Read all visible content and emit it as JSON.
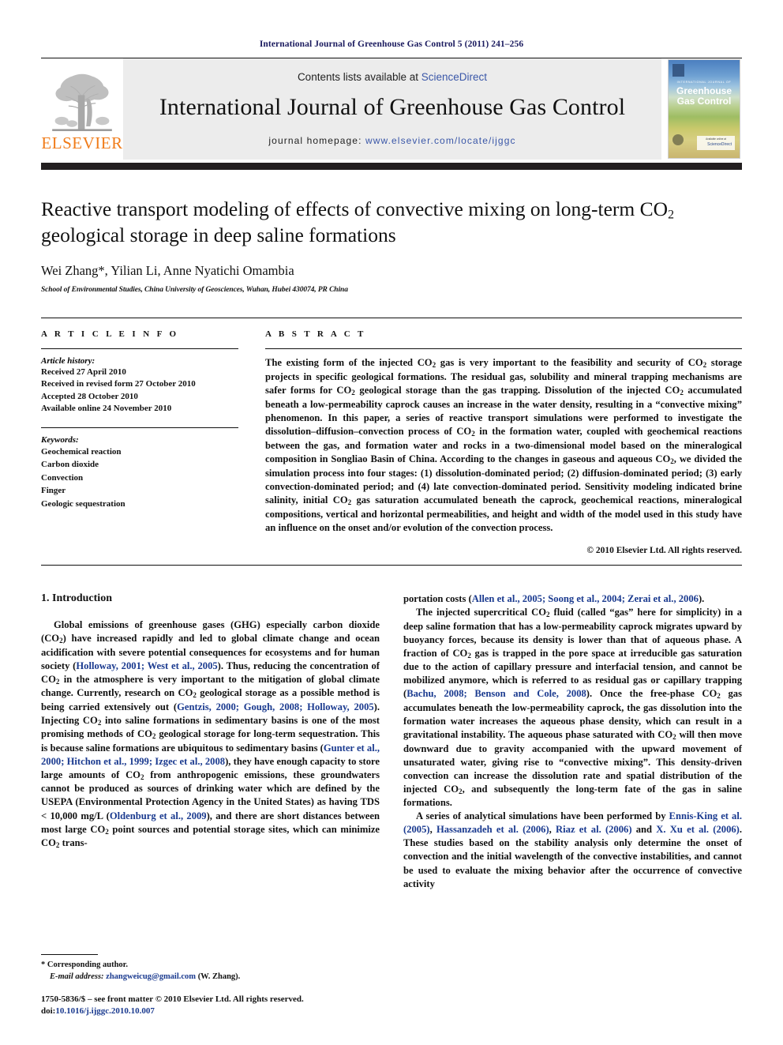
{
  "running_head": "International Journal of Greenhouse Gas Control 5 (2011) 241–256",
  "masthead": {
    "contents_prefix": "Contents lists available at ",
    "sciencedirect": "ScienceDirect",
    "journal_title": "International Journal of Greenhouse Gas Control",
    "homepage_prefix": "journal homepage: ",
    "homepage_url": "www.elsevier.com/locate/ijggc",
    "publisher_word": "ELSEVIER",
    "publisher_color": "#f07c1a",
    "link_color": "#3a57a8",
    "cover": {
      "kicker": "INTERNATIONAL JOURNAL OF",
      "title_line1": "Greenhouse",
      "title_line2": "Gas Control",
      "sd_caption": "Available online at",
      "sd_label": "ScienceDirect"
    }
  },
  "article": {
    "title_part1": "Reactive transport modeling of effects of convective mixing on long-term CO",
    "title_sub": "2",
    "title_part2": " geological storage in deep saline formations",
    "authors": "Wei Zhang*, Yilian Li, Anne Nyatichi Omambia",
    "affiliation": "School of Environmental Studies, China University of Geosciences, Wuhan, Hubei 430074, PR China"
  },
  "article_info": {
    "heading": "A R T I C L E   I N F O",
    "history_label": "Article history:",
    "history": [
      "Received 27 April 2010",
      "Received in revised form 27 October 2010",
      "Accepted 28 October 2010",
      "Available online 24 November 2010"
    ],
    "keywords_label": "Keywords:",
    "keywords": [
      "Geochemical reaction",
      "Carbon dioxide",
      "Convection",
      "Finger",
      "Geologic sequestration"
    ]
  },
  "abstract": {
    "heading": "A B S T R A C T",
    "paragraph_html": "The existing form of the injected CO<sub>2</sub> gas is very important to the feasibility and security of CO<sub>2</sub> storage projects in specific geological formations. The residual gas, solubility and mineral trapping mechanisms are safer forms for CO<sub>2</sub> geological storage than the gas trapping. Dissolution of the injected CO<sub>2</sub> accumulated beneath a low-permeability caprock causes an increase in the water density, resulting in a “convective mixing” phenomenon. In this paper, a series of reactive transport simulations were performed to investigate the dissolution–diffusion–convection process of CO<sub>2</sub> in the formation water, coupled with geochemical reactions between the gas, and formation water and rocks in a two-dimensional model based on the mineralogical composition in Songliao Basin of China. According to the changes in gaseous and aqueous CO<sub>2</sub>, we divided the simulation process into four stages: (1) dissolution-dominated period; (2) diffusion-dominated period; (3) early convection-dominated period; and (4) late convection-dominated period. Sensitivity modeling indicated brine salinity, initial CO<sub>2</sub> gas saturation accumulated beneath the caprock, geochemical reactions, mineralogical compositions, vertical and horizontal permeabilities, and height and width of the model used in this study have an influence on the onset and/or evolution of the convection process.",
    "copyright": "© 2010 Elsevier Ltd. All rights reserved."
  },
  "body": {
    "section_heading": "1.  Introduction",
    "left_paragraphs_html": [
      "Global emissions of greenhouse gases (GHG) especially carbon dioxide (CO<sub>2</sub>) have increased rapidly and led to global climate change and ocean acidification with severe potential consequences for ecosystems and for human society (<span class=\"ref\">Holloway, 2001; West et al., 2005</span>). Thus, reducing the concentration of CO<sub>2</sub> in the atmosphere is very important to the mitigation of global climate change. Currently, research on CO<sub>2</sub> geological storage as a possible method is being carried extensively out (<span class=\"ref\">Gentzis, 2000; Gough, 2008; Holloway, 2005</span>). Injecting CO<sub>2</sub> into saline formations in sedimentary basins is one of the most promising methods of CO<sub>2</sub> geological storage for long-term sequestration. This is because saline formations are ubiquitous to sedimentary basins (<span class=\"ref\">Gunter et al., 2000; Hitchon et al., 1999; Izgec et al., 2008</span>), they have enough capacity to store large amounts of CO<sub>2</sub> from anthropogenic emissions, these groundwaters cannot be produced as sources of drinking water which are defined by the USEPA (Environmental Protection Agency in the United States) as having TDS &lt; 10,000 mg/L (<span class=\"ref\">Oldenburg et al., 2009</span>), and there are short distances between most large CO<sub>2</sub> point sources and potential storage sites, which can minimize CO<sub>2</sub> trans-"
    ],
    "right_paragraphs_html": [
      "portation costs (<span class=\"ref\">Allen et al., 2005; Soong et al., 2004; Zerai et al., 2006</span>).",
      "The injected supercritical CO<sub>2</sub> fluid (called “gas” here for simplicity) in a deep saline formation that has a low-permeability caprock migrates upward by buoyancy forces, because its density is lower than that of aqueous phase. A fraction of CO<sub>2</sub> gas is trapped in the pore space at irreducible gas saturation due to the action of capillary pressure and interfacial tension, and cannot be mobilized anymore, which is referred to as residual gas or capillary trapping (<span class=\"ref\">Bachu, 2008; Benson and Cole, 2008</span>). Once the free-phase CO<sub>2</sub> gas accumulates beneath the low-permeability caprock, the gas dissolution into the formation water increases the aqueous phase density, which can result in a gravitational instability. The aqueous phase saturated with CO<sub>2</sub> will then move downward due to gravity accompanied with the upward movement of unsaturated water, giving rise to “convective mixing”. This density-driven convection can increase the dissolution rate and spatial distribution of the injected CO<sub>2</sub>, and subsequently the long-term fate of the gas in saline formations.",
      "A series of analytical simulations have been performed by <span class=\"ref\">Ennis-King et al. (2005)</span>, <span class=\"ref\">Hassanzadeh et al. (2006)</span>, <span class=\"ref\">Riaz et al. (2006)</span> and <span class=\"ref\">X. Xu et al. (2006)</span>. These studies based on the stability analysis only determine the onset of convection and the initial wavelength of the convective instabilities, and cannot be used to evaluate the mixing behavior after the occurrence of convective activity"
    ]
  },
  "footnote": {
    "corresponding": "* Corresponding author.",
    "email_label": "E-mail address:",
    "email": "zhangweicug@gmail.com",
    "email_suffix": " (W. Zhang).",
    "issn_line": "1750-5836/$ – see front matter © 2010 Elsevier Ltd. All rights reserved.",
    "doi_label": "doi:",
    "doi": "10.1016/j.ijggc.2010.10.007"
  }
}
